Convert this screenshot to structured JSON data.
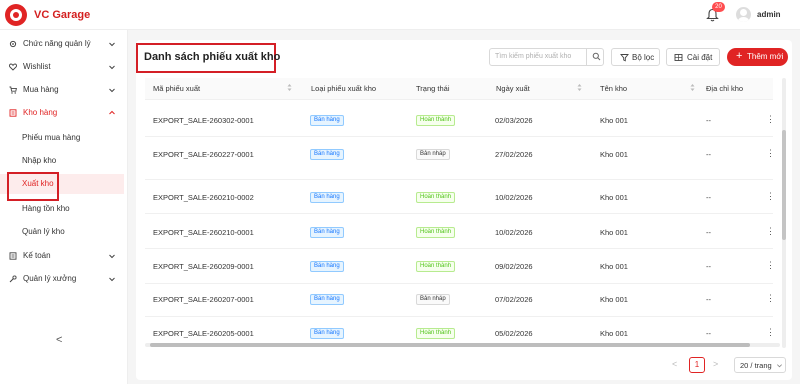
{
  "app": {
    "brand": "VC Garage",
    "notifications_count": "20",
    "username": "admin",
    "accent_color": "#e02424"
  },
  "sidebar": {
    "items": [
      {
        "label": "Chức năng quản lý",
        "icon": "gear-icon"
      },
      {
        "label": "Wishlist",
        "icon": "heart-icon"
      },
      {
        "label": "Mua hàng",
        "icon": "cart-icon"
      },
      {
        "label": "Kho hàng",
        "icon": "warehouse-icon"
      },
      {
        "label": "Kế toán",
        "icon": "ledger-icon"
      },
      {
        "label": "Quản lý xưởng",
        "icon": "wrench-icon"
      }
    ],
    "subitems": [
      {
        "label": "Phiếu mua hàng"
      },
      {
        "label": "Nhập kho"
      },
      {
        "label": "Xuất kho"
      },
      {
        "label": "Hàng tồn kho"
      },
      {
        "label": "Quản lý kho"
      }
    ],
    "collapse_label": "<"
  },
  "main": {
    "title": "Danh sách phiếu xuất kho",
    "search_placeholder": "Tìm kiếm phiếu xuất kho",
    "filter_label": "Bộ lọc",
    "settings_label": "Cài đặt",
    "add_label": "Thêm mới"
  },
  "table": {
    "headers": [
      "Mã phiếu xuất",
      "Loại phiếu xuất kho",
      "Trạng thái",
      "Ngày xuất",
      "Tên kho",
      "Địa chỉ kho"
    ],
    "rows": [
      {
        "code": "EXPORT_SALE-260302-0001",
        "type": "Bán hàng",
        "status": "Hoàn thành",
        "status_kind": "done",
        "date": "02/03/2026",
        "warehouse": "Kho 001",
        "address": "--"
      },
      {
        "code": "EXPORT_SALE-260227-0001",
        "type": "Bán hàng",
        "status": "Bản nháp",
        "status_kind": "draft",
        "date": "27/02/2026",
        "warehouse": "Kho 001",
        "address": "--"
      },
      {
        "code": "EXPORT_SALE-260210-0002",
        "type": "Bán hàng",
        "status": "Hoàn thành",
        "status_kind": "done",
        "date": "10/02/2026",
        "warehouse": "Kho 001",
        "address": "--"
      },
      {
        "code": "EXPORT_SALE-260210-0001",
        "type": "Bán hàng",
        "status": "Hoàn thành",
        "status_kind": "done",
        "date": "10/02/2026",
        "warehouse": "Kho 001",
        "address": "--"
      },
      {
        "code": "EXPORT_SALE-260209-0001",
        "type": "Bán hàng",
        "status": "Hoàn thành",
        "status_kind": "done",
        "date": "09/02/2026",
        "warehouse": "Kho 001",
        "address": "--"
      },
      {
        "code": "EXPORT_SALE-260207-0001",
        "type": "Bán hàng",
        "status": "Bản nháp",
        "status_kind": "draft",
        "date": "07/02/2026",
        "warehouse": "Kho 001",
        "address": "--"
      },
      {
        "code": "EXPORT_SALE-260205-0001",
        "type": "Bán hàng",
        "status": "Hoàn thành",
        "status_kind": "done",
        "date": "05/02/2026",
        "warehouse": "Kho 001",
        "address": "--"
      }
    ],
    "row_menu_glyph": "⋮"
  },
  "pagination": {
    "prev": "<",
    "current_page": "1",
    "next": ">",
    "page_size": "20 / trang"
  }
}
